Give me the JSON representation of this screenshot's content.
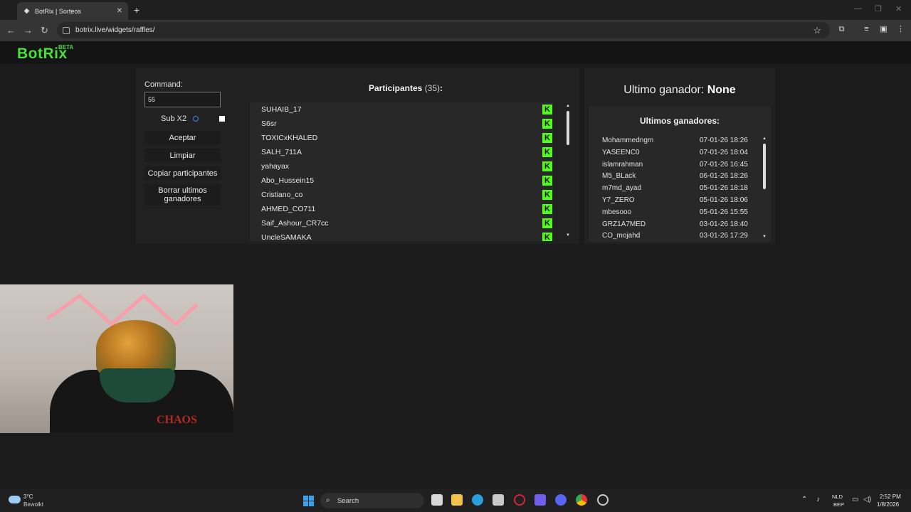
{
  "browser": {
    "tab_title": "BotRix | Sorteos",
    "url": "botrix.live/widgets/raffles/"
  },
  "site": {
    "logo": "BotRix",
    "beta": "BETA"
  },
  "controls": {
    "command_label": "Command:",
    "command_value": "55",
    "sub_x2_label": "Sub X2",
    "sub_x2_checked": false,
    "accept": "Aceptar",
    "clear": "Limpiar",
    "copy_participants": "Copiar participantes",
    "clear_winners_line1": "Borrar ultimos",
    "clear_winners_line2": "ganadores"
  },
  "participants": {
    "title": "Participantes",
    "count": "(35)",
    "colon": ":",
    "names": [
      "SUHAIB_17",
      "S6sr",
      "TOXICxKHALED",
      "SALH_711A",
      "yahayax",
      "Abo_Hussein15",
      "Cristiano_co",
      "AHMED_CO711",
      "Saif_Ashour_CR7cc",
      "UncleSAMAKA"
    ],
    "platform_icon": "kick-icon"
  },
  "winners": {
    "last_label": "Ultimo ganador:",
    "last_value": "None",
    "title": "Ultimos ganadores:",
    "rows": [
      {
        "name": "Mohammedngm",
        "date": "07-01-26 18:26"
      },
      {
        "name": "YASEENC0",
        "date": "07-01-26 18:04"
      },
      {
        "name": "islamrahman",
        "date": "07-01-26 16:45"
      },
      {
        "name": "M5_BLack",
        "date": "06-01-26 18:26"
      },
      {
        "name": "m7md_ayad",
        "date": "05-01-26 18:18"
      },
      {
        "name": "Y7_ZERO",
        "date": "05-01-26 18:06"
      },
      {
        "name": "mbesooo",
        "date": "05-01-26 15:55"
      },
      {
        "name": "GRZ1A7MED",
        "date": "03-01-26 18:40"
      },
      {
        "name": "CO_mojahd",
        "date": "03-01-26 17:29"
      }
    ]
  },
  "webcam": {
    "shirt_text": "CHAOS"
  },
  "taskbar": {
    "temp": "3°C",
    "weather": "Bewolkt",
    "search": "Search",
    "lang1": "NLD",
    "lang2": "BEP",
    "time": "2:52 PM",
    "date": "1/8/2026"
  },
  "colors": {
    "accent_green": "#4cde3a",
    "kick_green": "#53fc18",
    "panel_bg": "#212121",
    "list_bg": "#282828"
  }
}
